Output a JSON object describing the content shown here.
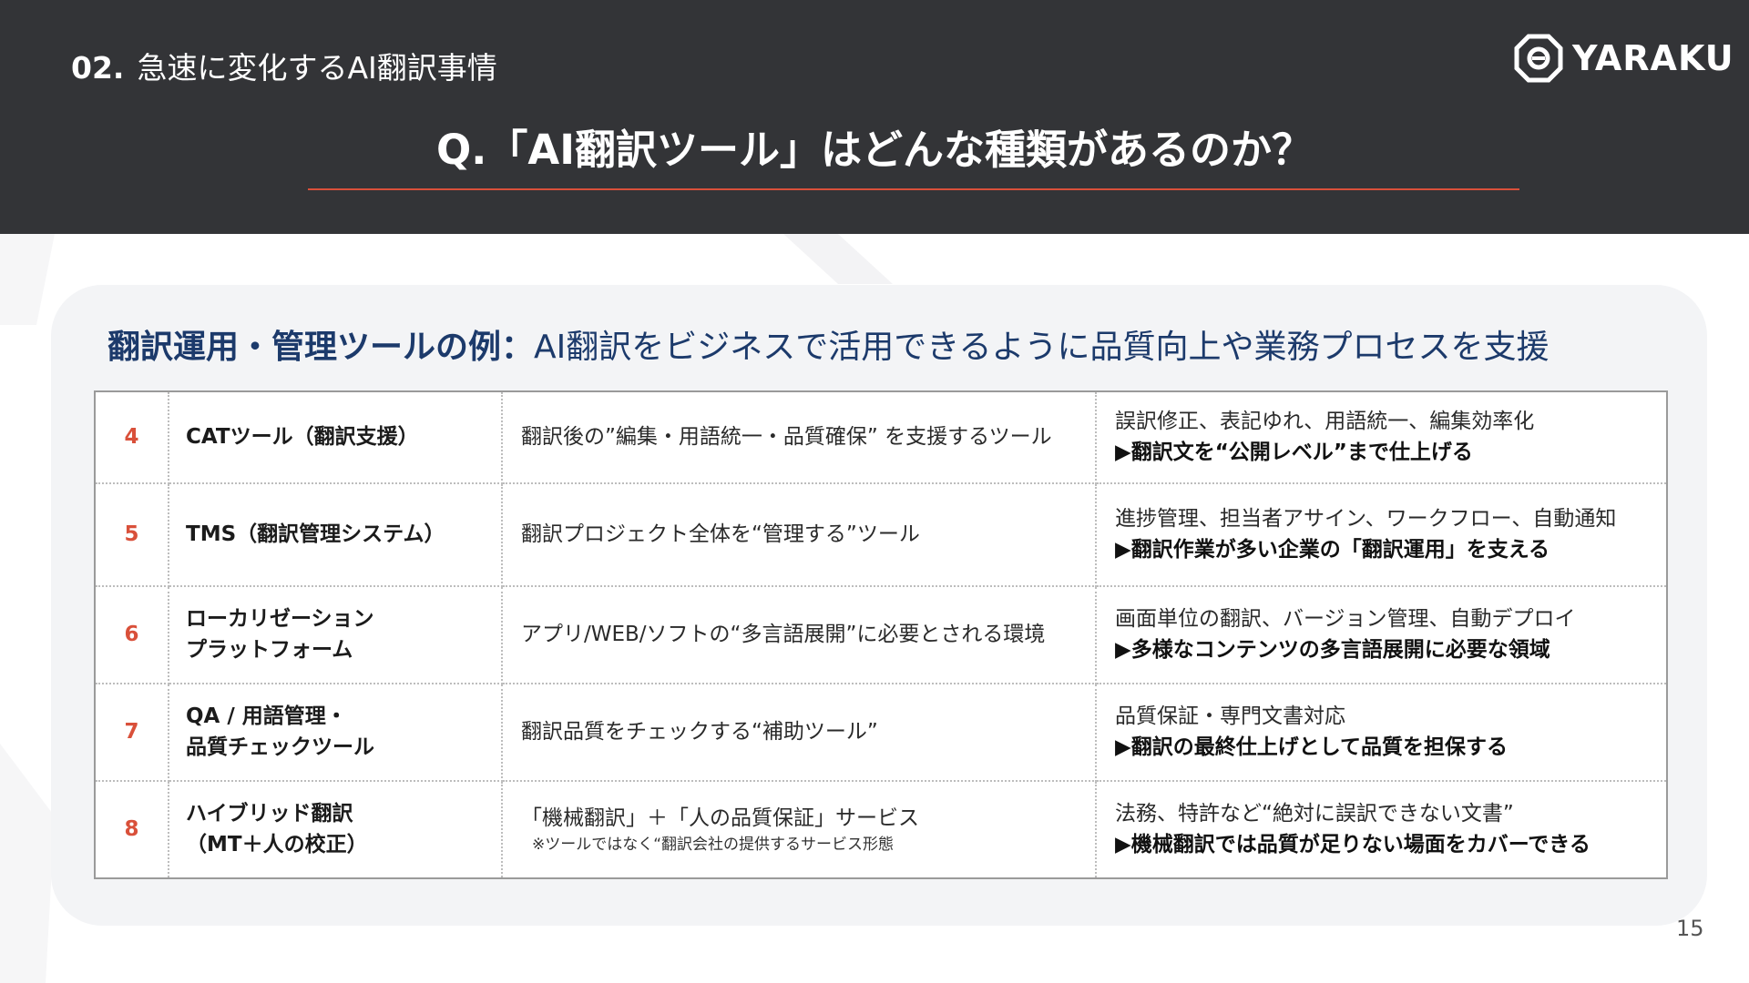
{
  "header": {
    "section_number": "02.",
    "section_title": "急速に変化するAI翻訳事情",
    "main_title": "Q.「AI翻訳ツール」はどんな種類があるのか？",
    "accent_color": "#d9503a",
    "background_color": "#333437"
  },
  "logo": {
    "text": "YARAKU",
    "icon": "yaraku-octagon-icon"
  },
  "card": {
    "heading_strong": "翻訳運用・管理ツールの例：",
    "heading_rest": "AI翻訳をビジネスで活用できるように品質向上や業務プロセスを支援"
  },
  "rows": [
    {
      "num": "4",
      "name_line1": "CATツール（翻訳支援）",
      "name_line2": "",
      "desc": "翻訳後の”編集・用語統一・品質確保” を支援するツール",
      "note": "",
      "detail": "誤訳修正、表記ゆれ、用語統一、編集効率化",
      "emphasis": "▶翻訳文を“公開レベル”まで仕上げる"
    },
    {
      "num": "5",
      "name_line1": "TMS（翻訳管理システム）",
      "name_line2": "",
      "desc": "翻訳プロジェクト全体を“管理する”ツール",
      "note": "",
      "detail": "進捗管理、担当者アサイン、ワークフロー、自動通知",
      "emphasis": "▶翻訳作業が多い企業の「翻訳運用」を支える"
    },
    {
      "num": "6",
      "name_line1": "ローカリゼーション",
      "name_line2": "プラットフォーム",
      "desc": "アプリ/WEB/ソフトの“多言語展開”に必要とされる環境",
      "note": "",
      "detail": "画面単位の翻訳、バージョン管理、自動デプロイ",
      "emphasis": "▶多様なコンテンツの多言語展開に必要な領域"
    },
    {
      "num": "7",
      "name_line1": "QA / 用語管理・",
      "name_line2": "品質チェックツール",
      "desc": "翻訳品質をチェックする“補助ツール”",
      "note": "",
      "detail": "品質保証・専門文書対応",
      "emphasis": "▶翻訳の最終仕上げとして品質を担保する"
    },
    {
      "num": "8",
      "name_line1": "ハイブリッド翻訳",
      "name_line2": "（MT＋人の校正）",
      "desc": "「機械翻訳」＋「人の品質保証」サービス",
      "note": "※ツールではなく“翻訳会社の提供するサービス形態",
      "detail": "法務、特許など“絶対に誤訳できない文書”",
      "emphasis": "▶機械翻訳では品質が足りない場面をカバーできる"
    }
  ],
  "page_number": "15"
}
